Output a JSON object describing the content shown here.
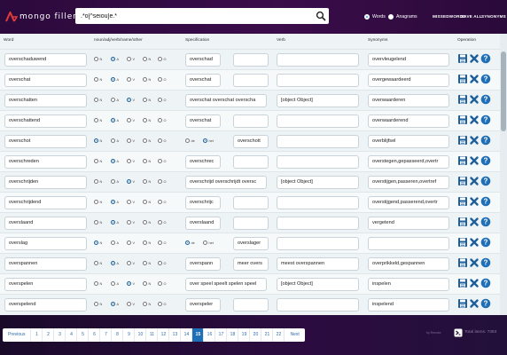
{
  "app": {
    "logo_text": "mongo filler",
    "search_value": ".*o[^seiou]e.*",
    "search_mode_words": "Words",
    "search_mode_anagrams": "Anagrams",
    "missed_words": "MISSEDWORDS",
    "save_all": "SAVE ALL",
    "synonyms": "SYNONYMS"
  },
  "columns": {
    "word": "Word",
    "type": "noun/adj/verb/name/other",
    "specification": "Specification",
    "verb": "Verb",
    "synonyms": "Synonyms",
    "operation": "Operation"
  },
  "radio_labels": [
    "N",
    "A",
    "V",
    "N",
    "O"
  ],
  "article_labels": [
    "de",
    "het"
  ],
  "rows": [
    {
      "word": "overschaduwend",
      "type": 1,
      "spec": "overschad",
      "spec2": "",
      "verb": "",
      "syn": "overvleugelend"
    },
    {
      "word": "overschat",
      "type": 1,
      "spec": "overschat",
      "spec2": "",
      "verb": "",
      "syn": "overgewaardeerd"
    },
    {
      "word": "overschatten",
      "type": 2,
      "spec": "overschat overschat overscha",
      "spec2": "",
      "verb": "[object Object]",
      "syn": "overwaarderen"
    },
    {
      "word": "overschattend",
      "type": 1,
      "spec": "overschat",
      "spec2": "",
      "verb": "",
      "syn": "overwaarderend"
    },
    {
      "word": "overschot",
      "type": 0,
      "spec": "",
      "spec2": "overschott",
      "verb": "",
      "syn": "overblijfsel",
      "article": 1
    },
    {
      "word": "overschreden",
      "type": 1,
      "spec": "overschrec",
      "spec2": "",
      "verb": "",
      "syn": "overstegen,gepasseerd,overtr"
    },
    {
      "word": "overschrijden",
      "type": 2,
      "spec": "overschrijd overschrijdt oversc",
      "spec2": "",
      "verb": "[object Object]",
      "syn": "overstijgen,passeren,overtref"
    },
    {
      "word": "overschrijdend",
      "type": 1,
      "spec": "overschrijc",
      "spec2": "",
      "verb": "",
      "syn": "overstijgend,passerend,overtr"
    },
    {
      "word": "overslaand",
      "type": 1,
      "spec": "overslaand",
      "spec2": "",
      "verb": "",
      "syn": "vergetend"
    },
    {
      "word": "overslag",
      "type": 0,
      "spec": "",
      "spec2": "overslager",
      "verb": "",
      "syn": "",
      "article": 0
    },
    {
      "word": "overspannen",
      "type": 1,
      "spec": "overspann",
      "spec2": "meer overs",
      "verb": "meest overspannen",
      "syn": "overprikkeld,gespannen"
    },
    {
      "word": "overspelen",
      "type": 2,
      "spec": "over speel speelt spelen speel",
      "spec2": "",
      "verb": "[object Object]",
      "syn": "inspelen"
    },
    {
      "word": "overspelend",
      "type": 1,
      "spec": "overspeler",
      "spec2": "",
      "verb": "",
      "syn": "inspelend"
    }
  ],
  "pagination": {
    "prev": "Previous",
    "next": "Next",
    "pages": [
      "1",
      "2",
      "3",
      "4",
      "5",
      "6",
      "7",
      "8",
      "9",
      "10",
      "11",
      "12",
      "13",
      "14",
      "15",
      "16",
      "17",
      "18",
      "19",
      "20",
      "21",
      "22"
    ],
    "active": "15"
  },
  "footer": {
    "byline": "by Renske",
    "total": "Total items: 7393"
  },
  "colors": {
    "accent": "#1f6fb8",
    "delete": "#1e5f99",
    "header_bg": "#3b0d4a"
  }
}
